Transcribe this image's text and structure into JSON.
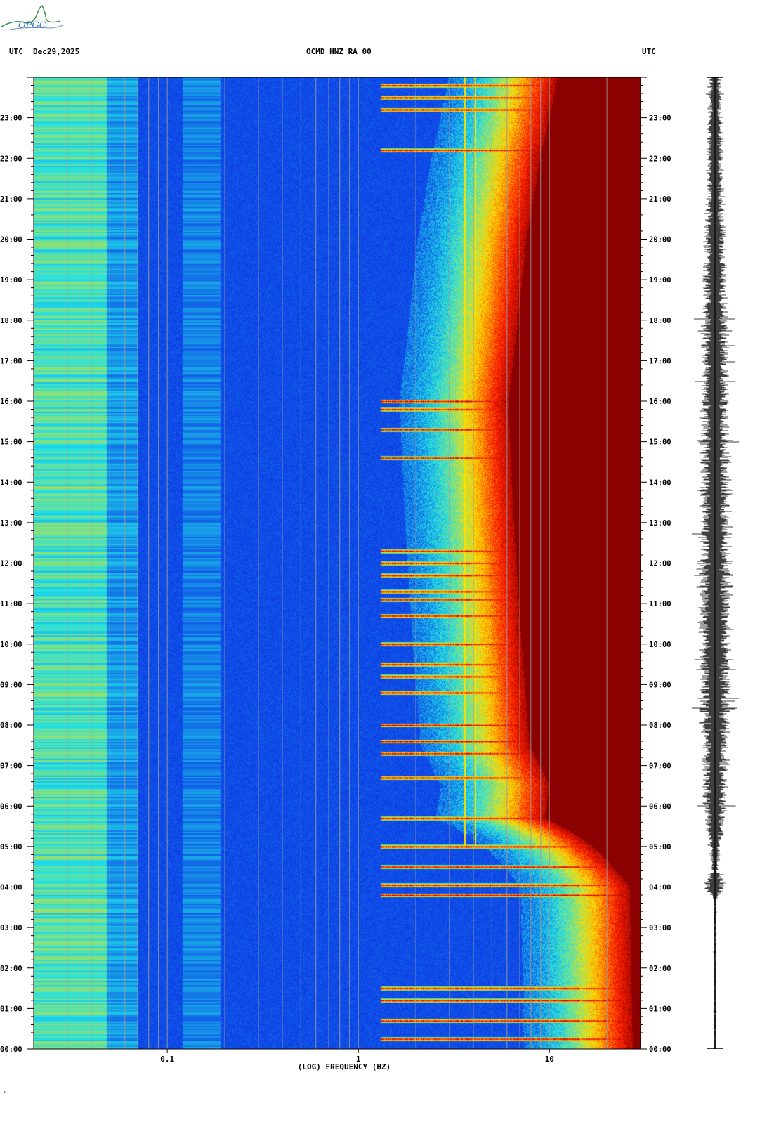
{
  "header": {
    "logo_text": "OPGC",
    "left_tz": "UTC",
    "date": "Dec29,2025",
    "station": "OCMD HNZ RA 00",
    "right_tz": "UTC"
  },
  "footer_mark": "ʼ",
  "colors": {
    "background_low": "#0a1ee6",
    "mid": "#1fe0e8",
    "high": "#ffe000",
    "saturated": "#8b0000",
    "grid": "#9a9a9a",
    "trace": "#000000"
  },
  "chart_data": [
    {
      "type": "heatmap",
      "title": "OCMD HNZ RA 00",
      "xlabel": "(LOG) FREQUENCY (HZ)",
      "x_scale": "log",
      "xlim": [
        0.02,
        30
      ],
      "x_ticks": [
        {
          "value": 0.1,
          "label": "0.1"
        },
        {
          "value": 1,
          "label": "1"
        },
        {
          "value": 10,
          "label": "10"
        }
      ],
      "x_gridlines": [
        0.03,
        0.04,
        0.05,
        0.06,
        0.07,
        0.08,
        0.09,
        0.1,
        0.2,
        0.3,
        0.4,
        0.5,
        0.6,
        0.7,
        0.8,
        0.9,
        1,
        2,
        3,
        4,
        5,
        6,
        7,
        8,
        9,
        10,
        20
      ],
      "ylabel_left": "UTC",
      "ylabel_right": "UTC",
      "y_unit": "hour UTC",
      "ylim": [
        0,
        24
      ],
      "y_ticks": [
        {
          "value": 0,
          "label": "00:00"
        },
        {
          "value": 1,
          "label": "01:00"
        },
        {
          "value": 2,
          "label": "02:00"
        },
        {
          "value": 3,
          "label": "03:00"
        },
        {
          "value": 4,
          "label": "04:00"
        },
        {
          "value": 5,
          "label": "05:00"
        },
        {
          "value": 6,
          "label": "06:00"
        },
        {
          "value": 7,
          "label": "07:00"
        },
        {
          "value": 8,
          "label": "08:00"
        },
        {
          "value": 9,
          "label": "09:00"
        },
        {
          "value": 10,
          "label": "10:00"
        },
        {
          "value": 11,
          "label": "11:00"
        },
        {
          "value": 12,
          "label": "12:00"
        },
        {
          "value": 13,
          "label": "13:00"
        },
        {
          "value": 14,
          "label": "14:00"
        },
        {
          "value": 15,
          "label": "15:00"
        },
        {
          "value": 16,
          "label": "16:00"
        },
        {
          "value": 17,
          "label": "17:00"
        },
        {
          "value": 18,
          "label": "18:00"
        },
        {
          "value": 19,
          "label": "19:00"
        },
        {
          "value": 20,
          "label": "20:00"
        },
        {
          "value": 21,
          "label": "21:00"
        },
        {
          "value": 22,
          "label": "22:00"
        },
        {
          "value": 23,
          "label": "23:00"
        }
      ],
      "y_minor_step": 0.2,
      "colormap": [
        "#0a1ee6",
        "#1fe0e8",
        "#ffe000",
        "#ff2000",
        "#8b0000"
      ],
      "saturation_edge_hz": [
        {
          "hour": 0,
          "freq": 26
        },
        {
          "hour": 4,
          "freq": 25
        },
        {
          "hour": 5,
          "freq": 16
        },
        {
          "hour": 5.7,
          "freq": 9
        },
        {
          "hour": 6.5,
          "freq": 9.5
        },
        {
          "hour": 7.5,
          "freq": 7.5
        },
        {
          "hour": 10,
          "freq": 6.8
        },
        {
          "hour": 13,
          "freq": 6.2
        },
        {
          "hour": 16,
          "freq": 5.8
        },
        {
          "hour": 18,
          "freq": 6.5
        },
        {
          "hour": 20,
          "freq": 7.2
        },
        {
          "hour": 22,
          "freq": 8.5
        },
        {
          "hour": 24,
          "freq": 10.5
        }
      ],
      "low_freq_band": {
        "freq_min": 0.02,
        "freq_max": 0.048,
        "level": 0.3
      },
      "narrowband_lines_hz": [
        3.6,
        4.1
      ],
      "event_hours": [
        0.25,
        0.7,
        1.2,
        1.5,
        3.8,
        4.05,
        4.5,
        5.0,
        5.7,
        6.7,
        7.3,
        7.6,
        8.0,
        8.8,
        9.2,
        9.5,
        10.0,
        10.7,
        11.1,
        11.3,
        11.7,
        12.0,
        12.3,
        14.6,
        15.3,
        15.8,
        16.0,
        22.2,
        23.2,
        23.5,
        23.8
      ]
    },
    {
      "type": "line",
      "title": "",
      "ylim": [
        0,
        24
      ],
      "y_unit": "hour UTC",
      "envelope": [
        {
          "hour": 0,
          "amp": 0.05
        },
        {
          "hour": 3.7,
          "amp": 0.05
        },
        {
          "hour": 4.0,
          "amp": 0.45
        },
        {
          "hour": 4.4,
          "amp": 0.12
        },
        {
          "hour": 5.0,
          "amp": 0.25
        },
        {
          "hour": 6.0,
          "amp": 0.45
        },
        {
          "hour": 7.5,
          "amp": 0.55
        },
        {
          "hour": 10.0,
          "amp": 0.6
        },
        {
          "hour": 12.0,
          "amp": 0.62
        },
        {
          "hour": 16.0,
          "amp": 0.55
        },
        {
          "hour": 19.0,
          "amp": 0.45
        },
        {
          "hour": 22.0,
          "amp": 0.32
        },
        {
          "hour": 24.0,
          "amp": 0.25
        }
      ]
    }
  ]
}
